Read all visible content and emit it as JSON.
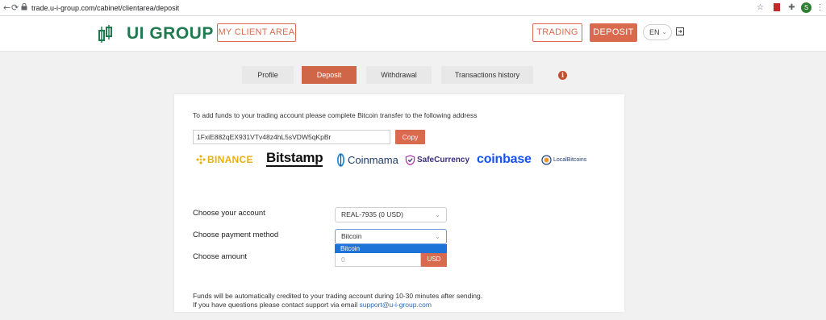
{
  "browser": {
    "url": "trade.u-i-group.com/cabinet/clientarea/deposit",
    "back_icon": "arrow-left-icon",
    "forward_icon": "arrow-right-icon",
    "reload_icon": "reload-icon",
    "profile_initial": "S"
  },
  "header": {
    "logo_text": "UI GROUP",
    "client_area_label": "MY CLIENT AREA",
    "trading_label": "TRADING",
    "deposit_label": "DEPOSIT",
    "language": "EN",
    "accent_color": "#d96a4e",
    "brand_color": "#1f7a4f"
  },
  "tabs": [
    {
      "label": "Profile",
      "active": false
    },
    {
      "label": "Deposit",
      "active": true
    },
    {
      "label": "Withdrawal",
      "active": false
    },
    {
      "label": "Transactions history",
      "active": false
    }
  ],
  "deposit": {
    "intro": "To add funds to your trading account please complete Bitcoin transfer to the following address",
    "address": "1FxiE882qEX931VTv48z4hL5sVDW5qKpBr",
    "copy_label": "Copy",
    "exchanges": [
      "BINANCE",
      "Bitstamp",
      "Coinmama",
      "SafeCurrency",
      "coinbase",
      "LocalBitcoins"
    ],
    "account_label": "Choose your account",
    "account_value": "REAL-7935 (0 USD)",
    "method_label": "Choose payment method",
    "method_value": "Bitcoin",
    "method_options": [
      "Bitcoin"
    ],
    "amount_label": "Choose amount",
    "amount_placeholder": "0",
    "currency": "USD",
    "note_line1": "Funds will be automatically credited to your trading account during 10-30 minutes after sending.",
    "note_line2_prefix": "If you have questions please contact support via email ",
    "support_email": "support@u-i-group.com"
  }
}
